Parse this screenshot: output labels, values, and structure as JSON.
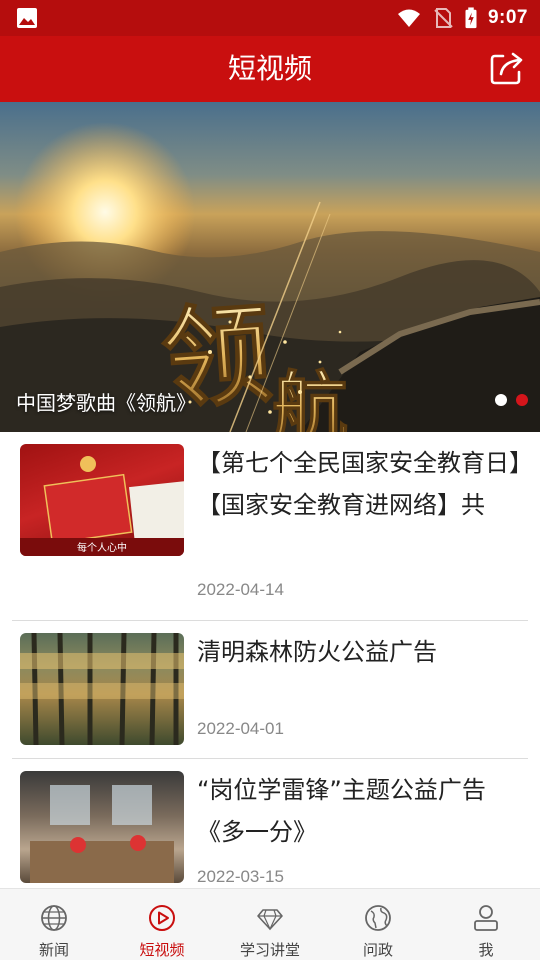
{
  "status_bar": {
    "time": "9:07",
    "icons": [
      "image-icon",
      "wifi-icon",
      "no-sim-icon",
      "battery-charging-icon"
    ]
  },
  "header": {
    "title": "短视频",
    "share_icon": "share-icon"
  },
  "banner": {
    "caption": "中国梦歌曲《领航》",
    "overlay_text": "领航",
    "page_count": 2,
    "active_page": 2
  },
  "videos": [
    {
      "title": "【第七个全民国家安全教育日】【国家安全教育进网络】共",
      "date": "2022-04-14",
      "thumb_caption": "每个人心中"
    },
    {
      "title": "清明森林防火公益广告",
      "date": "2022-04-01"
    },
    {
      "title": "“岗位学雷锋”主题公益广告《多一分》",
      "date": "2022-03-15"
    }
  ],
  "bottom_nav": [
    {
      "label": "新闻",
      "icon": "globe-icon",
      "active": false
    },
    {
      "label": "短视频",
      "icon": "play-circle-icon",
      "active": true
    },
    {
      "label": "学习讲堂",
      "icon": "diamond-icon",
      "active": false
    },
    {
      "label": "问政",
      "icon": "earth-icon",
      "active": false
    },
    {
      "label": "我",
      "icon": "user-icon",
      "active": false
    }
  ],
  "colors": {
    "brand_red": "#c90f0f",
    "status_red": "#b50d0d",
    "active_dot": "#d4151b"
  }
}
